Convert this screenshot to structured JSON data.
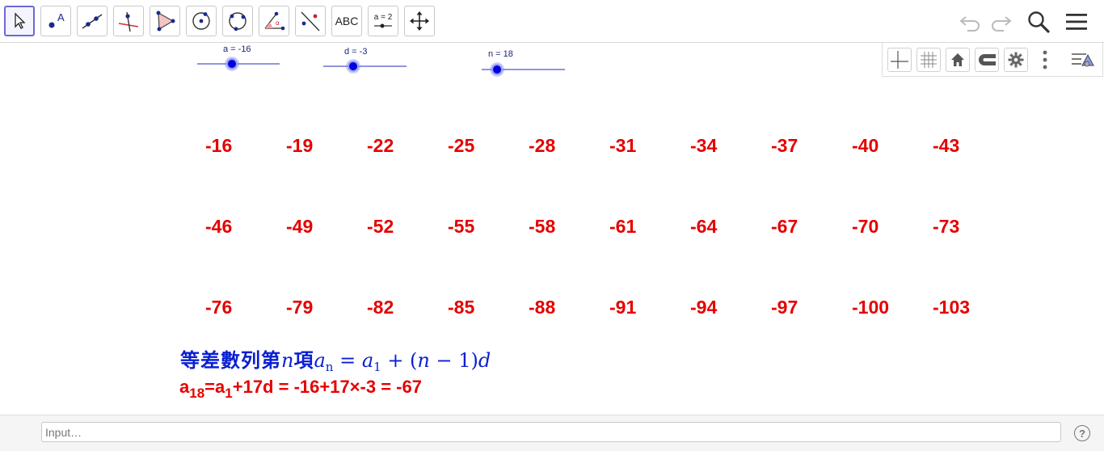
{
  "toolbar": {
    "tools": [
      {
        "name": "move-tool",
        "icon": "pointer-arrow-icon"
      },
      {
        "name": "point-tool",
        "icon": "point-icon",
        "label": "A"
      },
      {
        "name": "line-tool",
        "icon": "line-icon"
      },
      {
        "name": "perpendicular-line-tool",
        "icon": "perpendicular-icon"
      },
      {
        "name": "polygon-tool",
        "icon": "polygon-icon"
      },
      {
        "name": "circle-tool",
        "icon": "circle-center-icon"
      },
      {
        "name": "circle-three-points-tool",
        "icon": "circle-three-points-icon"
      },
      {
        "name": "angle-tool",
        "icon": "angle-icon"
      },
      {
        "name": "reflect-tool",
        "icon": "reflect-icon"
      },
      {
        "name": "text-tool",
        "icon": "text-icon",
        "label": "ABC"
      },
      {
        "name": "slider-tool",
        "icon": "slider-icon",
        "label": "a = 2"
      },
      {
        "name": "move-graphics-tool",
        "icon": "move-arrows-icon"
      }
    ],
    "right": [
      "undo-icon",
      "redo-icon",
      "search-icon",
      "menu-icon"
    ]
  },
  "graphics_style_bar": [
    "axes-icon",
    "grid-icon",
    "home-icon",
    "magnet-icon",
    "gear-icon",
    "more-vert-icon",
    "style-bar-toggle-icon"
  ],
  "sliders": [
    {
      "label": "a = -16",
      "value": -16
    },
    {
      "label": "d = -3",
      "value": -3
    },
    {
      "label": "n = 18",
      "value": 18
    }
  ],
  "sequence": [
    [
      "-16",
      "-19",
      "-22",
      "-25",
      "-28",
      "-31",
      "-34",
      "-37",
      "-40",
      "-43"
    ],
    [
      "-46",
      "-49",
      "-52",
      "-55",
      "-58",
      "-61",
      "-64",
      "-67",
      "-70",
      "-73"
    ],
    [
      "-76",
      "-79",
      "-82",
      "-85",
      "-88",
      "-91",
      "-94",
      "-97",
      "-100",
      "-103"
    ]
  ],
  "formula": {
    "cjk1": "等差數列第",
    "n": "n",
    "cjk2": "項",
    "a": "a",
    "sub_n": "n",
    "eq": " = ",
    "a1": "a",
    "sub_1": "1",
    "rest": " + (",
    "n2": "n",
    "minus": " − 1)",
    "d": "d"
  },
  "calc": {
    "a": "a",
    "sub18": "18",
    "eq_a": "=a",
    "sub1": "1",
    "rest": "+17d = -16+17×-3 = -67"
  },
  "input_bar": {
    "placeholder": "Input…",
    "help": "?"
  },
  "colors": {
    "sequence": "#e60000",
    "formula": "#0a1fd0",
    "slider": "#0000e0"
  }
}
